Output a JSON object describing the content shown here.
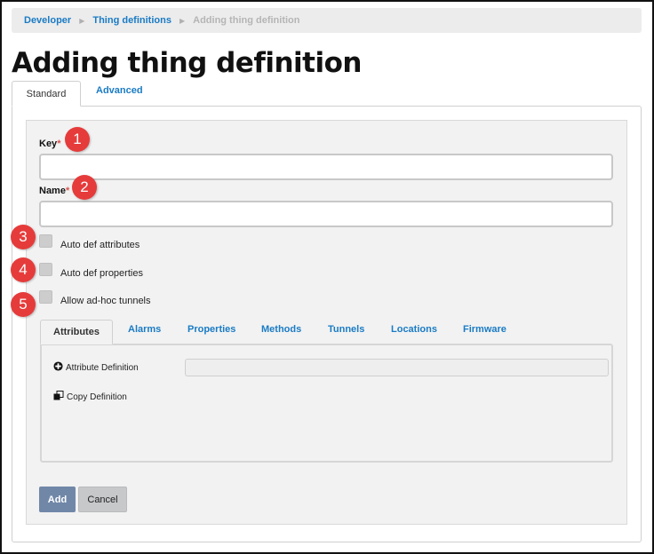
{
  "breadcrumb": {
    "items": [
      "Developer",
      "Thing definitions",
      "Adding thing definition"
    ]
  },
  "page": {
    "title": "Adding thing definition"
  },
  "tabs": {
    "standard": "Standard",
    "advanced": "Advanced"
  },
  "form": {
    "key": {
      "label": "Key",
      "required_mark": "*",
      "value": ""
    },
    "name": {
      "label": "Name",
      "required_mark": "*",
      "value": ""
    },
    "checkboxes": [
      {
        "label": "Auto def attributes",
        "checked": false
      },
      {
        "label": "Auto def properties",
        "checked": false
      },
      {
        "label": "Allow ad-hoc tunnels",
        "checked": false
      }
    ]
  },
  "callouts": [
    "1",
    "2",
    "3",
    "4",
    "5"
  ],
  "inner_tabs": [
    "Attributes",
    "Alarms",
    "Properties",
    "Methods",
    "Tunnels",
    "Locations",
    "Firmware"
  ],
  "attributes_panel": {
    "attribute_definition": {
      "label": "Attribute Definition",
      "icon": "plus-circle-icon",
      "value": ""
    },
    "copy_definition": {
      "label": "Copy Definition",
      "icon": "copy-icon"
    }
  },
  "buttons": {
    "add": "Add",
    "cancel": "Cancel"
  },
  "colors": {
    "link": "#1a7bc4",
    "callout": "#e63b3b",
    "primary_button": "#7087a8",
    "required": "#d9534f"
  }
}
